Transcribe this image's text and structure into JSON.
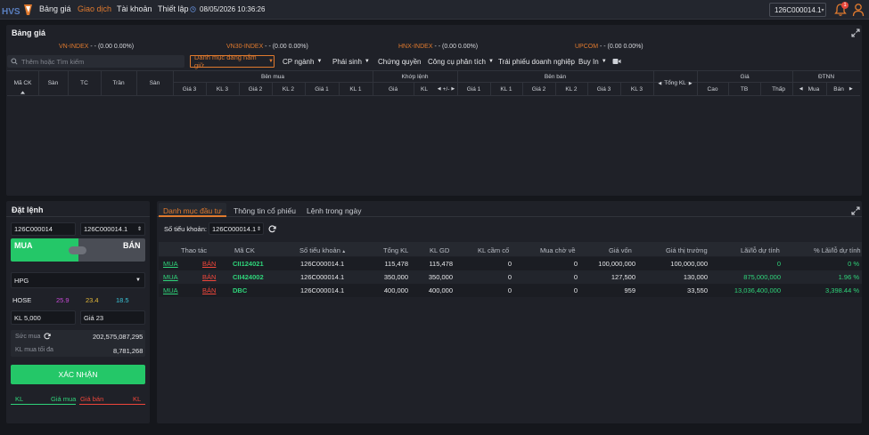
{
  "header": {
    "logo_text": "HVS",
    "nav": [
      "Bảng giá",
      "Giao dịch",
      "Tài khoản",
      "Thiết lập"
    ],
    "active_nav": "Giao dịch",
    "datetime": "08/05/2026 10:36:26",
    "account": "126C000014.1",
    "notification_count": "1"
  },
  "board": {
    "title": "Bảng giá",
    "indices": [
      {
        "name": "VN-INDEX",
        "value": " - - (0.00 0.00%)"
      },
      {
        "name": "VN30-INDEX",
        "value": " - - (0.00 0.00%)"
      },
      {
        "name": "HNX-INDEX",
        "value": " - - (0.00 0.00%)"
      },
      {
        "name": "UPCOM",
        "value": " - - (0.00 0.00%)"
      }
    ],
    "search_placeholder": "Thêm hoặc Tìm kiếm",
    "filters": {
      "category": "Danh mục đang nắm giữ",
      "sector": "CP ngành",
      "derivative": "Phái sinh",
      "warrant": "Chứng quyền",
      "tools": "Công cụ phân tích",
      "bond": "Trái phiếu doanh nghiệp",
      "buyin": "Buy In"
    },
    "columns": {
      "symbol": "Mã CK",
      "floor1": "Sàn",
      "ref": "TC",
      "ceil": "Trần",
      "floor2": "Sàn",
      "bid_group": "Bên mua",
      "match_group": "Khớp lệnh",
      "ask_group": "Bên bán",
      "price_group": "Giá",
      "foreign_group": "ĐTNN",
      "bid": [
        "Giá 3",
        "KL 3",
        "Giá 2",
        "KL 2",
        "Giá 1",
        "KL 1"
      ],
      "match": [
        "Giá",
        "KL",
        "+/-"
      ],
      "ask": [
        "Giá 1",
        "KL 1",
        "Giá 2",
        "KL 2",
        "Giá 3",
        "KL 3"
      ],
      "total_vol": "Tổng KL",
      "price": [
        "Cao",
        "TB",
        "Thấp"
      ],
      "foreign": [
        "Mua",
        "Bán"
      ]
    }
  },
  "order": {
    "title": "Đặt lệnh",
    "account_id": "126C000014",
    "sub_account": "126C000014.1",
    "buy_label": "MUA",
    "sell_label": "BÁN",
    "symbol": "HPG",
    "exchange": "HOSE",
    "ceil_price": "25.9",
    "ref_price": "23.4",
    "floor_price": "18.5",
    "quantity": "KL 5,000",
    "price": "Giá 23",
    "buying_power_label": "Sức mua",
    "buying_power": "202,575,087,295",
    "max_buy_label": "KL mua tối đa",
    "max_buy": "8,781,268",
    "confirm_label": "XÁC NHẬN",
    "book_headers": [
      "KL",
      "Giá mua",
      "Giá bán",
      "KL"
    ]
  },
  "portfolio": {
    "tabs": [
      "Danh mục đầu tư",
      "Thông tin cổ phiếu",
      "Lệnh trong ngày"
    ],
    "active_tab": "Danh mục đầu tư",
    "account_label": "Số tiểu khoản:",
    "account_value": "126C000014.1",
    "columns": [
      "Thao tác",
      "Mã CK",
      "Số tiểu khoản",
      "Tổng KL",
      "KL GD",
      "KL cầm cố",
      "Mua chờ về",
      "Giá vốn",
      "Giá thị trường",
      "Lãi/lỗ dự tính",
      "% Lãi/lỗ dự tính"
    ],
    "buy_action": "MUA",
    "sell_action": "BÁN",
    "rows": [
      {
        "symbol": "CII124021",
        "account": "126C000014.1",
        "total": "115,478",
        "tradable": "115,478",
        "pledged": "0",
        "pending": "0",
        "cost": "100,000,000",
        "market": "100,000,000",
        "pnl": "0",
        "pnl_pct": "0 %"
      },
      {
        "symbol": "CII424002",
        "account": "126C000014.1",
        "total": "350,000",
        "tradable": "350,000",
        "pledged": "0",
        "pending": "0",
        "cost": "127,500",
        "market": "130,000",
        "pnl": "875,000,000",
        "pnl_pct": "1.96 %"
      },
      {
        "symbol": "DBC",
        "account": "126C000014.1",
        "total": "400,000",
        "tradable": "400,000",
        "pledged": "0",
        "pending": "0",
        "cost": "959",
        "market": "33,550",
        "pnl": "13,036,400,000",
        "pnl_pct": "3,398.44 %"
      }
    ]
  },
  "colors": {
    "accent": "#e07a2e",
    "buy": "#24c768",
    "sell": "#f0463a",
    "background": "#15171c",
    "panel": "#1f2128"
  }
}
